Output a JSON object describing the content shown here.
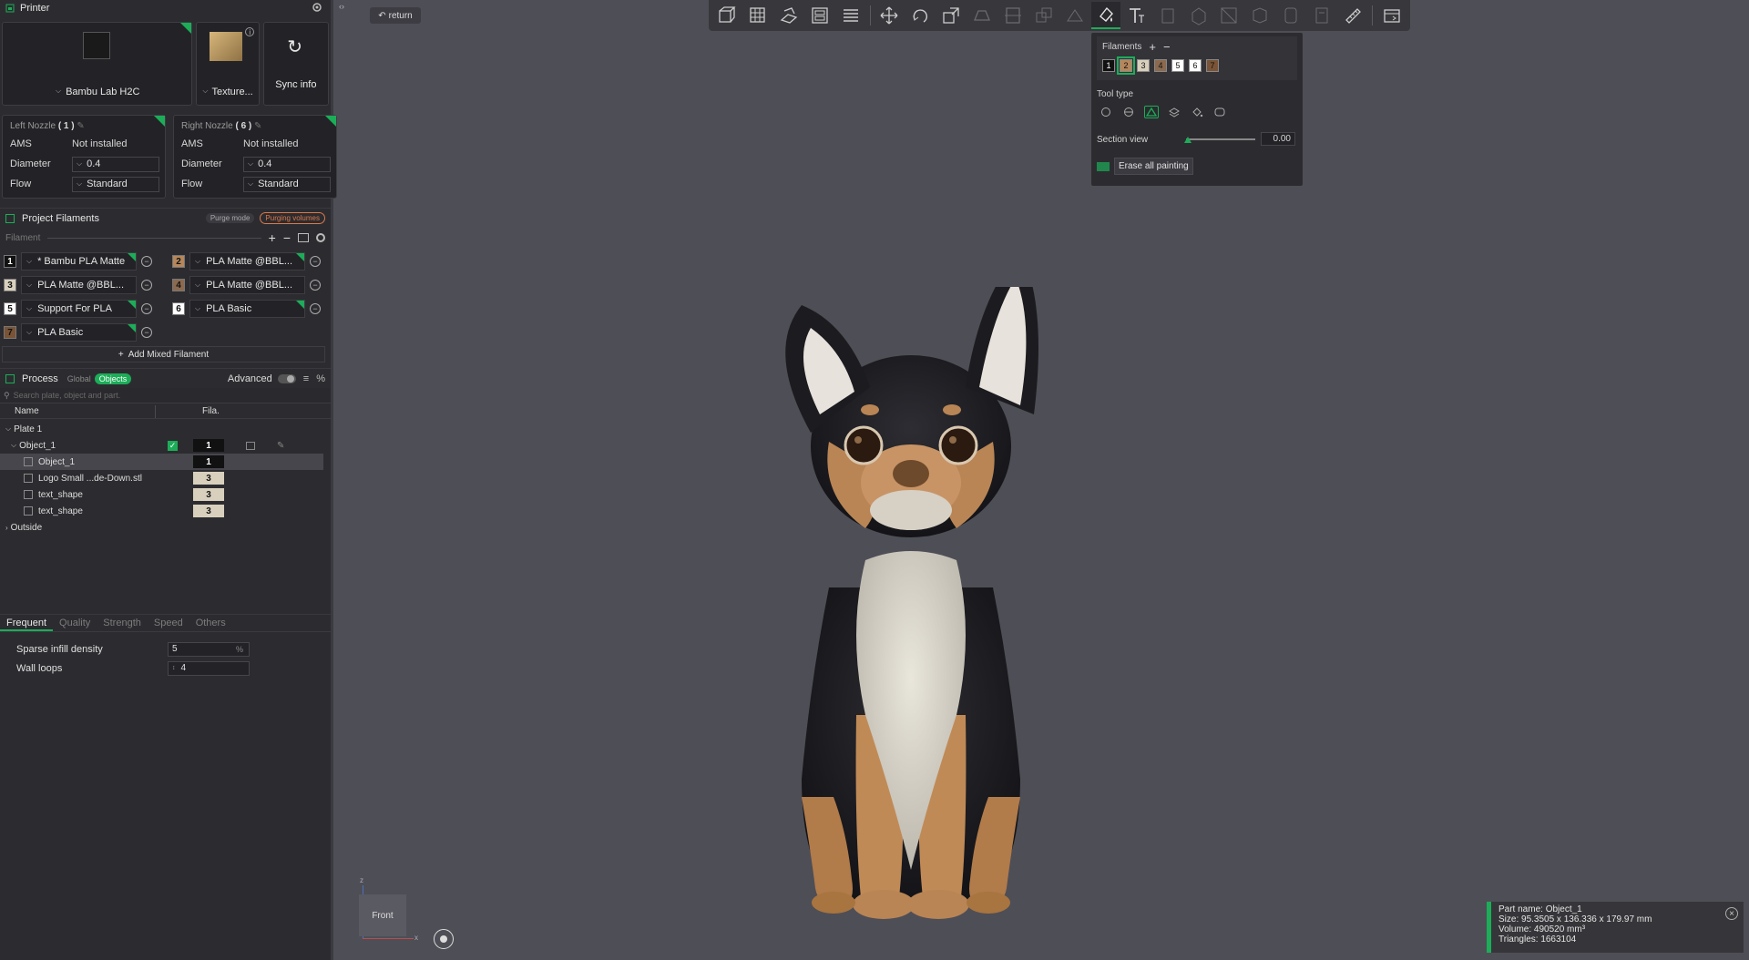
{
  "printer": {
    "title": "Printer",
    "model": "Bambu Lab H2C",
    "plate": "Texture...",
    "sync": "Sync info"
  },
  "nozzles": [
    {
      "title": "Left Nozzle",
      "index": "( 1 )",
      "ams_k": "AMS",
      "ams": "Not installed",
      "dia_k": "Diameter",
      "dia": "0.4",
      "flow_k": "Flow",
      "flow": "Standard"
    },
    {
      "title": "Right Nozzle",
      "index": "( 6 )",
      "ams_k": "AMS",
      "ams": "Not installed",
      "dia_k": "Diameter",
      "dia": "0.4",
      "flow_k": "Flow",
      "flow": "Standard"
    }
  ],
  "project_filaments": {
    "title": "Project Filaments",
    "purge_mode": "Purge mode",
    "purging_volumes": "Purging volumes",
    "filament_label": "Filament",
    "add_mixed": "Add Mixed Filament",
    "items": [
      {
        "n": "1",
        "name": "* Bambu PLA Matte",
        "color": "#111111",
        "text": "#ffffff"
      },
      {
        "n": "2",
        "name": "PLA Matte @BBL...",
        "color": "#b5875a",
        "text": "#111111"
      },
      {
        "n": "3",
        "name": "PLA Matte @BBL...",
        "color": "#d8d0bd",
        "text": "#111111"
      },
      {
        "n": "4",
        "name": "PLA Matte @BBL...",
        "color": "#8c6a4f",
        "text": "#111111"
      },
      {
        "n": "5",
        "name": "Support For PLA",
        "color": "#ffffff",
        "text": "#111111"
      },
      {
        "n": "6",
        "name": "PLA Basic",
        "color": "#ffffff",
        "text": "#111111"
      },
      {
        "n": "7",
        "name": "PLA Basic",
        "color": "#7a5436",
        "text": "#111111"
      }
    ]
  },
  "process": {
    "title": "Process",
    "global": "Global",
    "objects": "Objects",
    "advanced": "Advanced",
    "search_placeholder": "Search plate, object and part.",
    "col_name": "Name",
    "col_fila": "Fila.",
    "tree": [
      {
        "label": "Plate 1",
        "fila": "",
        "level": 0
      },
      {
        "label": "Object_1",
        "fila": "1",
        "level": 1
      },
      {
        "label": "Object_1",
        "fila": "1",
        "level": 2
      },
      {
        "label": "Logo Small ...de-Down.stl",
        "fila": "3",
        "level": 2
      },
      {
        "label": "text_shape",
        "fila": "3",
        "level": 2
      },
      {
        "label": "text_shape",
        "fila": "3",
        "level": 2
      },
      {
        "label": "Outside",
        "fila": "",
        "level": 0
      }
    ]
  },
  "settings_tabs": [
    "Frequent",
    "Quality",
    "Strength",
    "Speed",
    "Others"
  ],
  "settings": {
    "infill_label": "Sparse infill density",
    "infill_value": "5",
    "infill_unit": "%",
    "walls_label": "Wall loops",
    "walls_value": "4"
  },
  "viewport": {
    "return": "return",
    "view_label": "Front",
    "axis_z": "z",
    "axis_x": "x"
  },
  "paint_panel": {
    "filaments_label": "Filaments",
    "swatches": [
      {
        "n": "1",
        "color": "#111111",
        "text": "#ffffff"
      },
      {
        "n": "2",
        "color": "#b5875a",
        "text": "#111111"
      },
      {
        "n": "3",
        "color": "#d8d0bd",
        "text": "#111111"
      },
      {
        "n": "4",
        "color": "#8c6a4f",
        "text": "#111111"
      },
      {
        "n": "5",
        "color": "#ffffff",
        "text": "#111111"
      },
      {
        "n": "6",
        "color": "#ffffff",
        "text": "#111111"
      },
      {
        "n": "7",
        "color": "#7a5436",
        "text": "#111111"
      }
    ],
    "tool_type_label": "Tool type",
    "section_view_label": "Section view",
    "section_view_value": "0.00",
    "erase_label": "Erase all painting"
  },
  "part_info": {
    "name": "Part name: Object_1",
    "size": "Size: 95.3505 x 136.336 x 179.97 mm",
    "volume": "Volume: 490520 mm³",
    "triangles": "Triangles: 1663104"
  },
  "colors": {
    "accent": "#1cad58",
    "warn": "#d9784a"
  }
}
